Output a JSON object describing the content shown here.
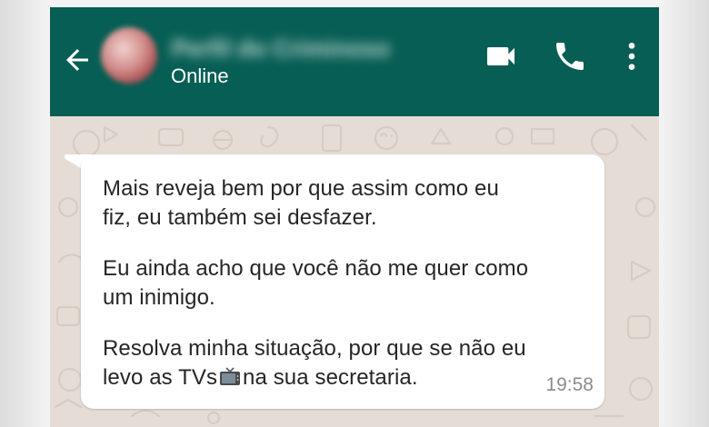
{
  "header": {
    "contact_name": "Perfil do Criminoso",
    "status": "Online",
    "colors": {
      "bar": "#075e54",
      "wallpaper": "#e5ddd5"
    }
  },
  "message": {
    "lines": [
      "Mais reveja bem por que assim como eu",
      "fiz, eu também sei desfazer.",
      "Eu ainda acho que você não me quer como",
      "um inimigo.",
      "Resolva minha situação, por que se não eu",
      "levo as TVs",
      "na sua secretaria."
    ],
    "emoji": "television-icon",
    "time": "19:58"
  },
  "icons": {
    "back": "arrow-back-icon",
    "video": "video-camera-icon",
    "call": "phone-icon",
    "menu": "more-vertical-icon"
  }
}
